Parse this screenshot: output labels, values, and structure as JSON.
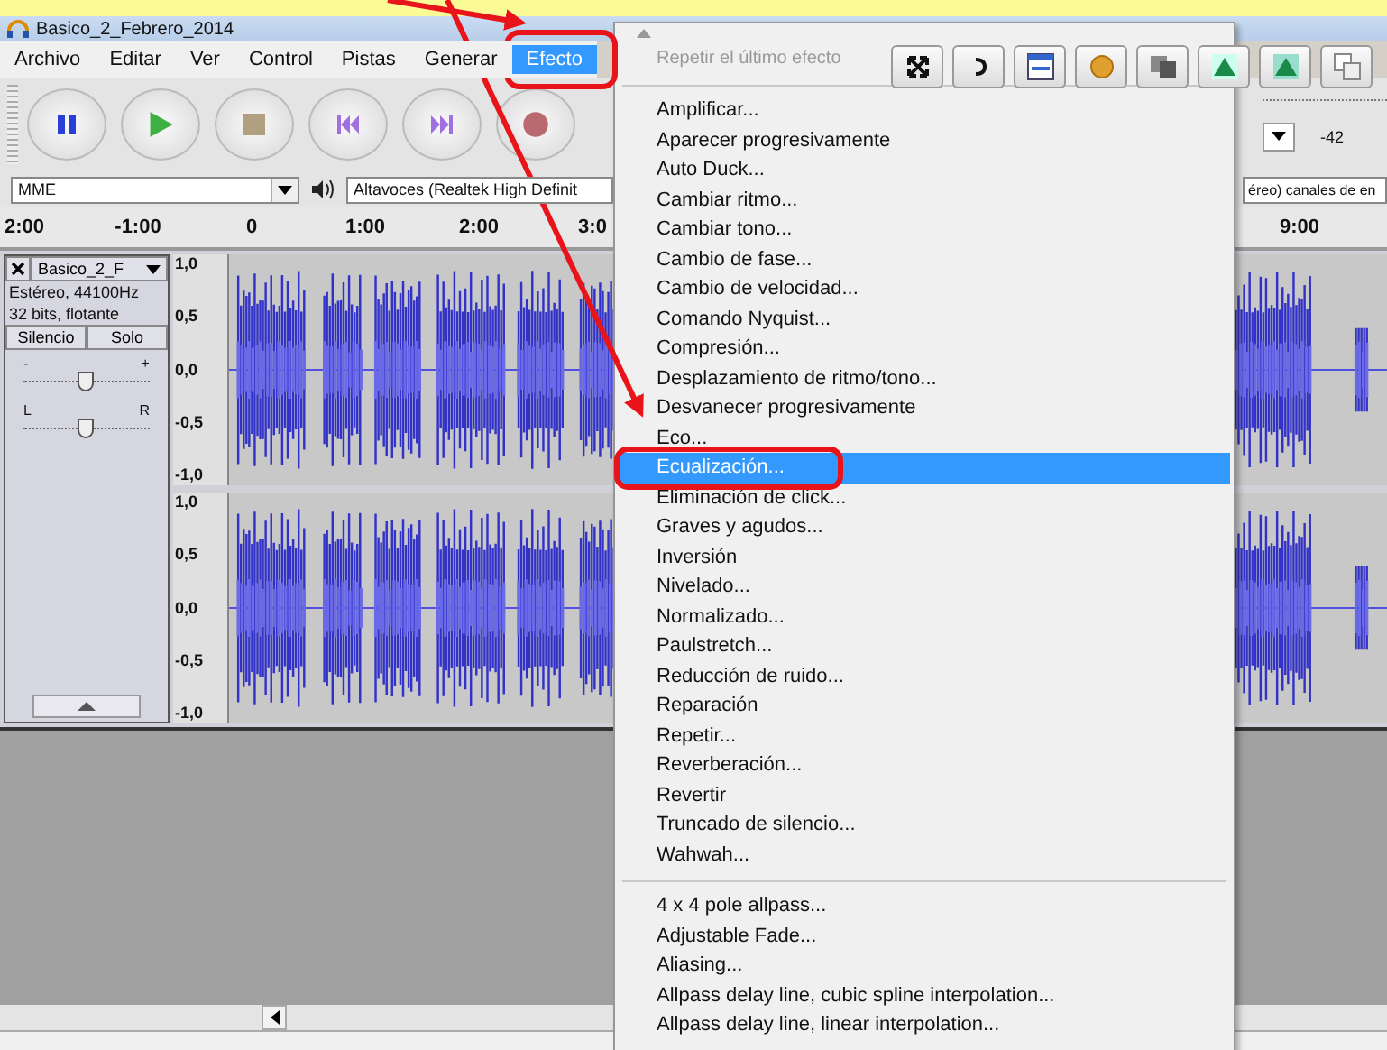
{
  "window": {
    "title": "Basico_2_Febrero_2014"
  },
  "menu_bar": [
    {
      "label": "Archivo",
      "selected": false
    },
    {
      "label": "Editar",
      "selected": false
    },
    {
      "label": "Ver",
      "selected": false
    },
    {
      "label": "Control",
      "selected": false
    },
    {
      "label": "Pistas",
      "selected": false
    },
    {
      "label": "Generar",
      "selected": false
    },
    {
      "label": "Efecto",
      "selected": true
    }
  ],
  "meter": {
    "tick": "-42"
  },
  "device_bar": {
    "host": "MME",
    "output_device": "Altavoces (Realtek High Definit",
    "input_channels": "éreo) canales de en"
  },
  "ruler": {
    "labels": [
      "2:00",
      "-1:00",
      "0",
      "1:00",
      "2:00",
      "3:0"
    ],
    "right_label": "9:00"
  },
  "track": {
    "name": "Basico_2_F",
    "info": [
      "Estéreo, 44100Hz",
      "32 bits, flotante"
    ],
    "mute": "Silencio",
    "solo": "Solo",
    "gain": {
      "minus": "-",
      "plus": "+",
      "level": 0.5
    },
    "pan": {
      "left": "L",
      "right": "R",
      "level": 0.5
    },
    "channels": [
      {
        "scale": [
          "1,0",
          "0,5",
          "0,0",
          "-0,5",
          "-1,0"
        ]
      },
      {
        "scale": [
          "1,0",
          "0,5",
          "0,0",
          "-0,5",
          "-1,0"
        ]
      }
    ]
  },
  "effect_menu": {
    "repeat": "Repetir el último efecto",
    "items": [
      {
        "label": "Amplificar...",
        "selected": false
      },
      {
        "label": "Aparecer progresivamente",
        "selected": false
      },
      {
        "label": "Auto Duck...",
        "selected": false
      },
      {
        "label": "Cambiar ritmo...",
        "selected": false
      },
      {
        "label": "Cambiar tono...",
        "selected": false
      },
      {
        "label": "Cambio de fase...",
        "selected": false
      },
      {
        "label": "Cambio de velocidad...",
        "selected": false
      },
      {
        "label": "Comando Nyquist...",
        "selected": false
      },
      {
        "label": "Compresión...",
        "selected": false
      },
      {
        "label": "Desplazamiento de ritmo/tono...",
        "selected": false
      },
      {
        "label": "Desvanecer progresivamente",
        "selected": false
      },
      {
        "label": "Eco...",
        "selected": false
      },
      {
        "label": "Ecualización...",
        "selected": true
      },
      {
        "label": "Eliminación de click...",
        "selected": false
      },
      {
        "label": "Graves y agudos...",
        "selected": false
      },
      {
        "label": "Inversión",
        "selected": false
      },
      {
        "label": "Nivelado...",
        "selected": false
      },
      {
        "label": "Normalizado...",
        "selected": false
      },
      {
        "label": "Paulstretch...",
        "selected": false
      },
      {
        "label": "Reducción de ruido...",
        "selected": false
      },
      {
        "label": "Reparación",
        "selected": false
      },
      {
        "label": "Repetir...",
        "selected": false
      },
      {
        "label": "Reverberación...",
        "selected": false
      },
      {
        "label": "Revertir",
        "selected": false
      },
      {
        "label": "Truncado de silencio...",
        "selected": false
      },
      {
        "label": "Wahwah...",
        "selected": false
      }
    ],
    "plugin_items": [
      {
        "label": "4 x 4 pole allpass...",
        "selected": false
      },
      {
        "label": "Adjustable Fade...",
        "selected": false
      },
      {
        "label": "Aliasing...",
        "selected": false
      },
      {
        "label": "Allpass delay line, cubic spline interpolation...",
        "selected": false
      },
      {
        "label": "Allpass delay line, linear interpolation...",
        "selected": false
      }
    ]
  }
}
